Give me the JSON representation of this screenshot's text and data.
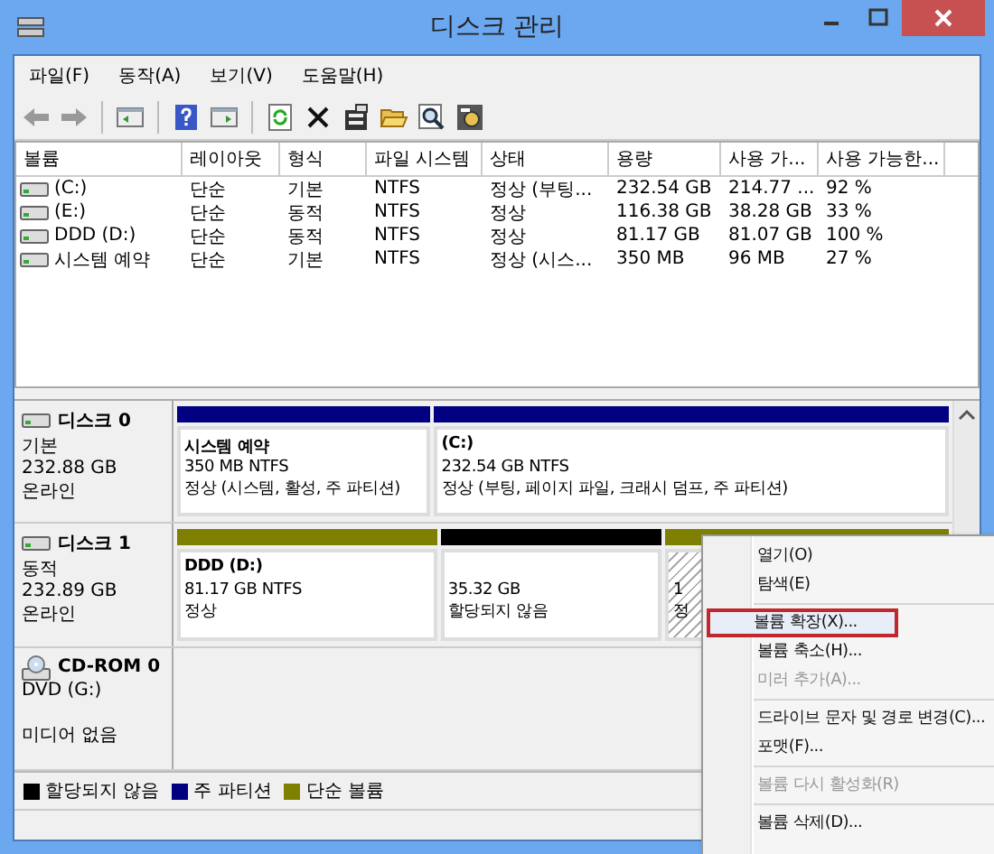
{
  "window": {
    "title": "디스크 관리"
  },
  "menu": [
    "파일(F)",
    "동작(A)",
    "보기(V)",
    "도움말(H)"
  ],
  "toolbar": [
    {
      "kind": "back"
    },
    {
      "kind": "forward"
    },
    {
      "kind": "pane"
    },
    {
      "kind": "help"
    },
    {
      "kind": "pane2"
    },
    {
      "kind": "refresh"
    },
    {
      "kind": "delete"
    },
    {
      "kind": "properties"
    },
    {
      "kind": "open"
    },
    {
      "kind": "search"
    },
    {
      "kind": "settings"
    }
  ],
  "table": {
    "columns": [
      "볼륨",
      "레이아웃",
      "형식",
      "파일 시스템",
      "상태",
      "용량",
      "사용 가...",
      "사용 가능한..."
    ],
    "rows": [
      {
        "cells": [
          "(C:)",
          "단순",
          "기본",
          "NTFS",
          "정상 (부팅...",
          "232.54 GB",
          "214.77 ...",
          "92 %"
        ]
      },
      {
        "cells": [
          "(E:)",
          "단순",
          "동적",
          "NTFS",
          "정상",
          "116.38 GB",
          "38.28 GB",
          "33 %"
        ]
      },
      {
        "cells": [
          "DDD (D:)",
          "단순",
          "동적",
          "NTFS",
          "정상",
          "81.17 GB",
          "81.07 GB",
          "100 %"
        ]
      },
      {
        "cells": [
          "시스템 예약",
          "단순",
          "기본",
          "NTFS",
          "정상 (시스...",
          "350 MB",
          "96 MB",
          "27 %"
        ]
      }
    ]
  },
  "disks": [
    {
      "kind": "disk",
      "name": "디스크 0",
      "lines": [
        "기본",
        "232.88 GB",
        "온라인"
      ],
      "partitions": [
        {
          "color": "#000080",
          "selected": false,
          "title": "시스템 예약",
          "lines": [
            "350 MB NTFS",
            "정상 (시스템, 활성, 주 파티션)"
          ]
        },
        {
          "color": "#000080",
          "selected": false,
          "title": "(C:)",
          "lines": [
            "232.54 GB NTFS",
            "정상 (부팅, 페이지 파일, 크래시 덤프, 주 파티션)"
          ]
        }
      ]
    },
    {
      "kind": "disk",
      "name": "디스크 1",
      "lines": [
        "동적",
        "232.89 GB",
        "온라인"
      ],
      "partitions": [
        {
          "color": "#808000",
          "selected": false,
          "title": "DDD  (D:)",
          "lines": [
            "81.17 GB NTFS",
            "정상"
          ]
        },
        {
          "color": "#000000",
          "selected": false,
          "lines": [
            "35.32 GB",
            "할당되지 않음"
          ]
        },
        {
          "color": "#808000",
          "selected": true,
          "lines": [
            "1",
            "정"
          ]
        }
      ]
    },
    {
      "kind": "cdrom",
      "name": "CD-ROM 0",
      "lines": [
        "DVD (G:)",
        "미디어 없음"
      ]
    }
  ],
  "legend": [
    {
      "label": "할당되지 않음",
      "color": "#000000"
    },
    {
      "label": "주 파티션",
      "color": "#000080"
    },
    {
      "label": "단순 볼륨",
      "color": "#808000"
    }
  ],
  "context_menu": [
    {
      "kind": "item",
      "label": "열기(O)",
      "disabled": false,
      "selected": false
    },
    {
      "kind": "item",
      "label": "탐색(E)",
      "disabled": false,
      "selected": false
    },
    {
      "kind": "separator"
    },
    {
      "kind": "item",
      "label": "볼륨 확장(X)...",
      "disabled": false,
      "selected": true
    },
    {
      "kind": "item",
      "label": "볼륨 축소(H)...",
      "disabled": false,
      "selected": false
    },
    {
      "kind": "item",
      "label": "미러 추가(A)...",
      "disabled": true,
      "selected": false
    },
    {
      "kind": "separator"
    },
    {
      "kind": "item",
      "label": "드라이브 문자 및 경로 변경(C)...",
      "disabled": false,
      "selected": false
    },
    {
      "kind": "item",
      "label": "포맷(F)...",
      "disabled": false,
      "selected": false
    },
    {
      "kind": "separator"
    },
    {
      "kind": "item",
      "label": "볼륨 다시 활성화(R)",
      "disabled": true,
      "selected": false
    },
    {
      "kind": "separator"
    },
    {
      "kind": "item",
      "label": "볼륨 삭제(D)...",
      "disabled": false,
      "selected": false
    }
  ]
}
